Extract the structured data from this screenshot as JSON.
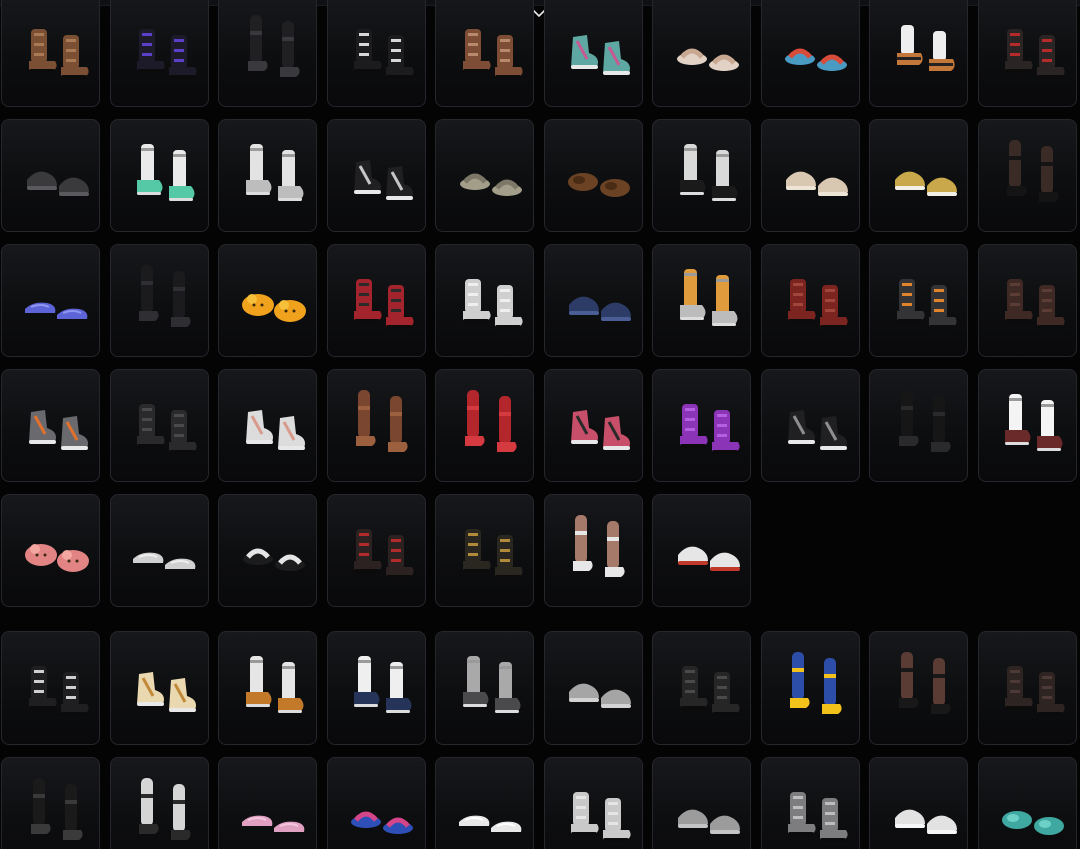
{
  "app": {
    "collapse_icon": "chevron-down-icon"
  },
  "sections": [
    {
      "name": "shoe-grid-main",
      "rows": 5,
      "items": [
        {
          "icon": "brown-combat-boots-icon",
          "kind": "boot",
          "main": "#7a4f33",
          "accent": "#a97a55"
        },
        {
          "icon": "purple-strap-boots-icon",
          "kind": "boot",
          "main": "#1d1b2a",
          "accent": "#5b3fc9"
        },
        {
          "icon": "black-tall-boots-icon",
          "kind": "tall",
          "main": "#202022",
          "accent": "#3a3a3e"
        },
        {
          "icon": "black-white-ankle-boots-icon",
          "kind": "boot",
          "main": "#1c1c1e",
          "accent": "#d8d8d8"
        },
        {
          "icon": "brown-cuffed-boots-icon",
          "kind": "boot",
          "main": "#7d4e35",
          "accent": "#b8896a"
        },
        {
          "icon": "colorful-hightop-sneakers-icon",
          "kind": "sneaker",
          "main": "#5fa7a3",
          "accent": "#c65a91"
        },
        {
          "icon": "beige-slides-icon",
          "kind": "slide",
          "main": "#e2d2c6",
          "accent": "#c9a892"
        },
        {
          "icon": "blue-flip-flops-icon",
          "kind": "slide",
          "main": "#4a9bc4",
          "accent": "#d94c3a"
        },
        {
          "icon": "tiger-sandals-icon",
          "kind": "sandal",
          "main": "#c37738",
          "accent": "#eeeeee"
        },
        {
          "icon": "red-wrapped-boots-icon",
          "kind": "boot",
          "main": "#2a2524",
          "accent": "#b52a2a"
        },
        {
          "icon": "gray-low-sneakers-icon",
          "kind": "low",
          "main": "#3a3a3c",
          "accent": "#5a5a5e"
        },
        {
          "icon": "mint-sneakers-white-socks-icon",
          "kind": "sock",
          "main": "#55c8a6",
          "accent": "#eaeaea"
        },
        {
          "icon": "white-slouch-boots-icon",
          "kind": "sock",
          "main": "#bdbdbd",
          "accent": "#e3e3e3"
        },
        {
          "icon": "black-silver-hightops-icon",
          "kind": "sneaker",
          "main": "#202022",
          "accent": "#c5c5c5"
        },
        {
          "icon": "khaki-slides-icon",
          "kind": "slide",
          "main": "#a39e8a",
          "accent": "#7c7766"
        },
        {
          "icon": "bear-paw-slippers-icon",
          "kind": "slipper",
          "main": "#6b4223",
          "accent": "#4a2c15"
        },
        {
          "icon": "white-socks-black-shoes-icon",
          "kind": "sock",
          "main": "#1a1a1b",
          "accent": "#d9d9d9"
        },
        {
          "icon": "beige-low-sneakers-icon",
          "kind": "low",
          "main": "#d8c7b1",
          "accent": "#eee4d6"
        },
        {
          "icon": "gold-white-sneakers-icon",
          "kind": "low",
          "main": "#c8a84a",
          "accent": "#f1efe6"
        },
        {
          "icon": "fishnet-tall-boots-icon",
          "kind": "tall",
          "main": "#3a2b26",
          "accent": "#151414"
        },
        {
          "icon": "blue-flats-icon",
          "kind": "flat",
          "main": "#5d64d8",
          "accent": "#8f96f0"
        },
        {
          "icon": "black-stockings-icon",
          "kind": "tall",
          "main": "#1b1b1d",
          "accent": "#2f2f33"
        },
        {
          "icon": "yellow-cat-slippers-icon",
          "kind": "plush",
          "main": "#f0a21c",
          "accent": "#f6c03a"
        },
        {
          "icon": "red-black-boots-icon",
          "kind": "boot",
          "main": "#a3242c",
          "accent": "#2a2a2a"
        },
        {
          "icon": "white-chunky-boots-icon",
          "kind": "boot",
          "main": "#cfcfcf",
          "accent": "#efefef"
        },
        {
          "icon": "navy-sneakers-icon",
          "kind": "low",
          "main": "#2d3c66",
          "accent": "#4a5e95"
        },
        {
          "icon": "gray-sock-sneakers-icon",
          "kind": "sock",
          "main": "#bcbcbc",
          "accent": "#e09b3d"
        },
        {
          "icon": "red-leather-boots-icon",
          "kind": "boot",
          "main": "#7c2520",
          "accent": "#a2453a"
        },
        {
          "icon": "orange-steel-boots-icon",
          "kind": "boot",
          "main": "#343437",
          "accent": "#e2842a"
        },
        {
          "icon": "dark-brown-boots-icon",
          "kind": "boot",
          "main": "#3e2925",
          "accent": "#5c3d36"
        },
        {
          "icon": "gray-orange-hightops-icon",
          "kind": "sneaker",
          "main": "#6a6a6e",
          "accent": "#e1702c"
        },
        {
          "icon": "black-laced-boots-icon",
          "kind": "boot",
          "main": "#2a2a2c",
          "accent": "#4a4a4c"
        },
        {
          "icon": "white-pink-hightops-icon",
          "kind": "sneaker",
          "main": "#dcdcdc",
          "accent": "#d89a8a"
        },
        {
          "icon": "brown-knee-boots-icon",
          "kind": "tall",
          "main": "#7a4630",
          "accent": "#9c603f"
        },
        {
          "icon": "red-thigh-boots-icon",
          "kind": "tall",
          "main": "#b3262c",
          "accent": "#d43a40"
        },
        {
          "icon": "pink-black-hightops-icon",
          "kind": "sneaker",
          "main": "#c84f6a",
          "accent": "#2a2a2a"
        },
        {
          "icon": "purple-boots-icon",
          "kind": "boot",
          "main": "#8c34b8",
          "accent": "#b45ee0"
        },
        {
          "icon": "black-hightops-icon",
          "kind": "sneaker",
          "main": "#202022",
          "accent": "#8e8e90"
        },
        {
          "icon": "black-tights-shoes-icon",
          "kind": "tall",
          "main": "#161617",
          "accent": "#2a2a2c"
        },
        {
          "icon": "white-socks-mary-janes-icon",
          "kind": "sock",
          "main": "#6b2a2a",
          "accent": "#f4f4f4"
        },
        {
          "icon": "pink-fuzzy-slippers-icon",
          "kind": "plush",
          "main": "#e28484",
          "accent": "#f3a7a0"
        },
        {
          "icon": "white-loafers-icon",
          "kind": "flat",
          "main": "#d0d0d0",
          "accent": "#eeeeee"
        },
        {
          "icon": "black-bow-slides-icon",
          "kind": "slide",
          "main": "#1c1c1d",
          "accent": "#e5e5e5"
        },
        {
          "icon": "red-lace-combat-boots-icon",
          "kind": "boot",
          "main": "#2d2222",
          "accent": "#b32a2a"
        },
        {
          "icon": "gold-buckle-boots-icon",
          "kind": "boot",
          "main": "#2a2721",
          "accent": "#b28a3a"
        },
        {
          "icon": "bare-legs-white-sneakers-icon",
          "kind": "tall",
          "main": "#a57a6a",
          "accent": "#e7e7e7"
        },
        {
          "icon": "white-red-sneakers-icon",
          "kind": "low",
          "main": "#e6e6e6",
          "accent": "#c0392b"
        }
      ]
    },
    {
      "name": "shoe-grid-secondary",
      "rows": 2,
      "items": [
        {
          "icon": "striped-black-boots-icon",
          "kind": "boot",
          "main": "#1f1f21",
          "accent": "#cfcfcf"
        },
        {
          "icon": "dotted-hightops-icon",
          "kind": "sneaker",
          "main": "#e9d8b0",
          "accent": "#c18a3a"
        },
        {
          "icon": "orange-white-sock-boots-icon",
          "kind": "sock",
          "main": "#c27a2a",
          "accent": "#e6e6e6"
        },
        {
          "icon": "white-navy-sock-shoes-icon",
          "kind": "sock",
          "main": "#26345a",
          "accent": "#efefef"
        },
        {
          "icon": "gray-slouch-sock-boots-icon",
          "kind": "sock",
          "main": "#4a4a4c",
          "accent": "#a9a9a9"
        },
        {
          "icon": "gray-sock-booties-icon",
          "kind": "low",
          "main": "#a5a5a5",
          "accent": "#d2d2d2"
        },
        {
          "icon": "black-combat-boots-icon",
          "kind": "boot",
          "main": "#262626",
          "accent": "#4a4a4a"
        },
        {
          "icon": "blue-yellow-lightning-boots-icon",
          "kind": "tall",
          "main": "#2c4ea8",
          "accent": "#f2c21a"
        },
        {
          "icon": "fishnet-heels-icon",
          "kind": "tall",
          "main": "#5a3c34",
          "accent": "#181818"
        },
        {
          "icon": "dark-buckle-boots-icon",
          "kind": "boot",
          "main": "#2e2523",
          "accent": "#4d3a36"
        },
        {
          "icon": "black-thigh-high-boots-icon",
          "kind": "tall",
          "main": "#1a1a1a",
          "accent": "#3a3a3a"
        },
        {
          "icon": "striped-leg-warmers-icon",
          "kind": "tall",
          "main": "#d5d5d5",
          "accent": "#2a2a2a"
        },
        {
          "icon": "pink-mary-janes-icon",
          "kind": "flat",
          "main": "#e0a0c2",
          "accent": "#f2c6dc"
        },
        {
          "icon": "blue-pink-flip-flops-icon",
          "kind": "slide",
          "main": "#2f4fb8",
          "accent": "#d4458a"
        },
        {
          "icon": "white-flats-icon",
          "kind": "flat",
          "main": "#e8e8e8",
          "accent": "#ffffff"
        },
        {
          "icon": "white-military-boots-icon",
          "kind": "boot",
          "main": "#c9c9c9",
          "accent": "#e5e5e5"
        },
        {
          "icon": "gray-sneakers-icon",
          "kind": "low",
          "main": "#9c9c9c",
          "accent": "#c4c4c4"
        },
        {
          "icon": "gray-moon-boots-icon",
          "kind": "boot",
          "main": "#7d7d7f",
          "accent": "#bdbdbd"
        },
        {
          "icon": "white-mesh-sneakers-icon",
          "kind": "low",
          "main": "#e2e2e2",
          "accent": "#f7f7f7"
        },
        {
          "icon": "teal-clogs-icon",
          "kind": "slipper",
          "main": "#3fa8a0",
          "accent": "#6cd0c6"
        }
      ]
    }
  ]
}
